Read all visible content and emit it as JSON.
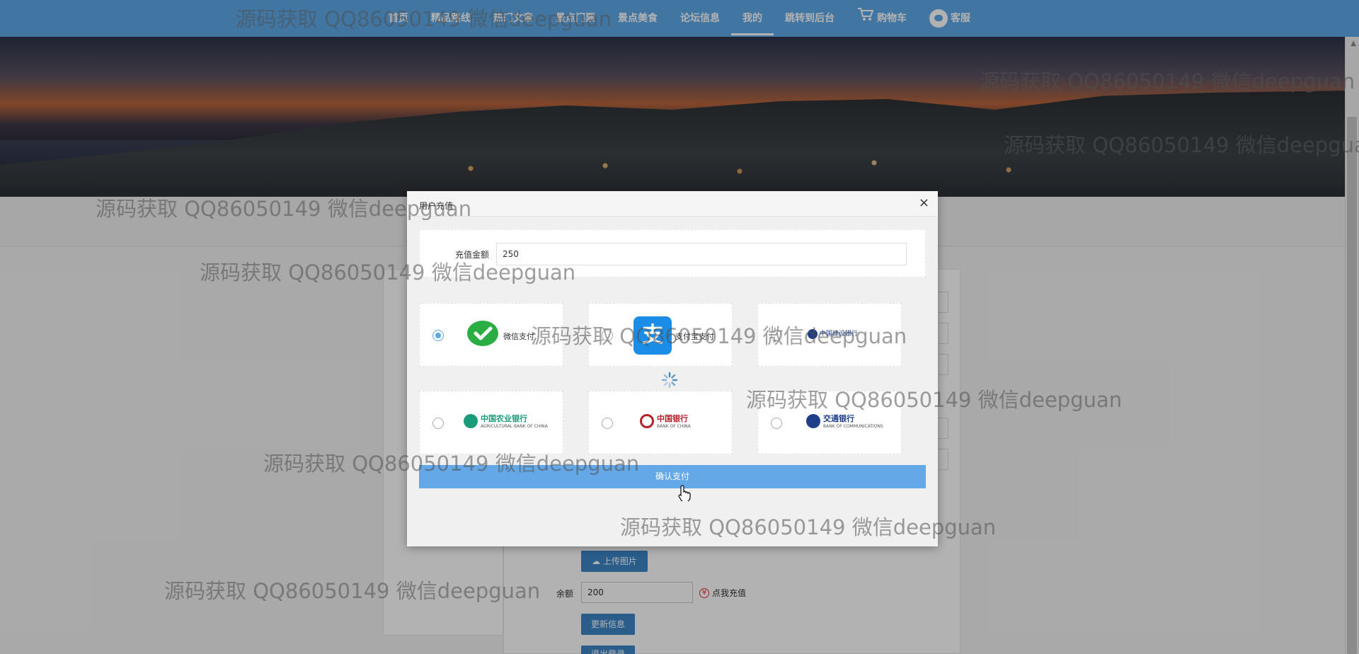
{
  "nav": {
    "items": [
      {
        "label": "首页"
      },
      {
        "label": "精品路线"
      },
      {
        "label": "热门文章"
      },
      {
        "label": "景点门票"
      },
      {
        "label": "景点美食"
      },
      {
        "label": "论坛信息"
      },
      {
        "label": "我的",
        "active": true
      },
      {
        "label": "跳转到后台"
      }
    ],
    "cart_label": "购物车",
    "service_label": "客服"
  },
  "background_page": {
    "upload_button": "上传图片",
    "balance_label": "余额",
    "balance_value": "200",
    "recharge_link": "点我充值",
    "update_button": "更新信息",
    "logout_button": "退出登录"
  },
  "modal": {
    "title": "用户充值",
    "close": "×",
    "amount_label": "充值金额",
    "amount_value": "250",
    "payment_options": [
      {
        "name": "微信支付",
        "selected": true
      },
      {
        "name": "支付宝支付",
        "selected": false
      },
      {
        "name": "中国建设银行",
        "selected": false
      },
      {
        "name": "中国农业银行",
        "selected": false
      },
      {
        "name": "中国银行",
        "selected": false
      },
      {
        "name": "交通银行",
        "selected": false
      }
    ],
    "bank_subtitles": {
      "abc": "AGRICULTURAL BANK OF CHINA",
      "boc": "BANK OF CHINA",
      "bocom": "BANK OF COMMUNICATIONS"
    },
    "confirm_button": "确认支付"
  },
  "watermark": "源码获取 QQ86050149 微信deepguan",
  "colors": {
    "nav_bg": "#5ea8e8",
    "button_blue": "#3e86c8",
    "confirm_blue": "#64a8e8",
    "wechat_green": "#2aae44",
    "alipay_blue": "#1b8de6"
  }
}
